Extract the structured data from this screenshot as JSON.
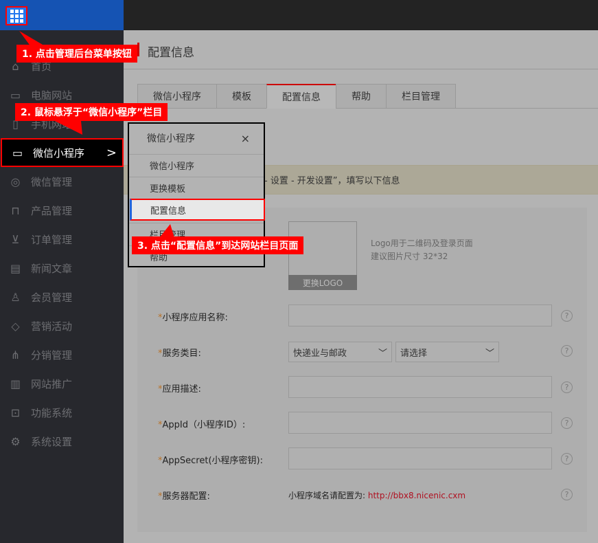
{
  "sidebar": {
    "items": [
      {
        "label": "首页",
        "icon": "home-icon"
      },
      {
        "label": "电脑网站",
        "icon": "monitor-icon"
      },
      {
        "label": "手机网站",
        "icon": "phone-icon"
      },
      {
        "label": "微信小程序",
        "icon": "monitor-icon",
        "active": true
      },
      {
        "label": "微信管理",
        "icon": "chat-icon"
      },
      {
        "label": "产品管理",
        "icon": "bag-icon"
      },
      {
        "label": "订单管理",
        "icon": "cart-icon"
      },
      {
        "label": "新闻文章",
        "icon": "document-icon"
      },
      {
        "label": "会员管理",
        "icon": "user-icon"
      },
      {
        "label": "营销活动",
        "icon": "tag-icon"
      },
      {
        "label": "分销管理",
        "icon": "sitemap-icon"
      },
      {
        "label": "网站推广",
        "icon": "bar-chart-icon"
      },
      {
        "label": "功能系统",
        "icon": "toolbox-icon"
      },
      {
        "label": "系统设置",
        "icon": "gear-icon"
      }
    ]
  },
  "page": {
    "title": "配置信息"
  },
  "tabs": [
    {
      "label": "微信小程序"
    },
    {
      "label": "模板"
    },
    {
      "label": "配置信息",
      "active": true
    },
    {
      "label": "帮助"
    },
    {
      "label": "栏目管理"
    }
  ],
  "notice": "- 设置 - 开发设置”，填写以下信息",
  "logo": {
    "button": "更换LOGO",
    "hint1": "Logo用于二维码及登录页面",
    "hint2": "建议图片尺寸 32*32"
  },
  "form": {
    "name_label": "小程序应用名称:",
    "category_label": "服务类目:",
    "category1": "快递业与邮政",
    "category2": "请选择",
    "desc_label": "应用描述:",
    "appid_label": "AppId（小程序ID）:",
    "secret_label": "AppSecret(小程序密钥):",
    "server_label": "服务器配置:",
    "server_text": "小程序域名请配置为:",
    "server_url": "http://bbx8.nicenic.cxm",
    "required": "*",
    "help": "?"
  },
  "popup": {
    "title": "微信小程序",
    "close": "×",
    "items": [
      "微信小程序",
      "更换模板",
      "配置信息",
      "栏目管理",
      "帮助"
    ]
  },
  "annotations": [
    "1. 点击管理后台菜单按钮",
    "2. 鼠标悬浮于“微信小程序”栏目",
    "3. 点击“配置信息”到达网站栏目页面"
  ],
  "colors": {
    "accent": "#cc0000",
    "annotation": "#ff0000",
    "sidebar": "#27282d",
    "logo_bar": "#1553b3"
  }
}
